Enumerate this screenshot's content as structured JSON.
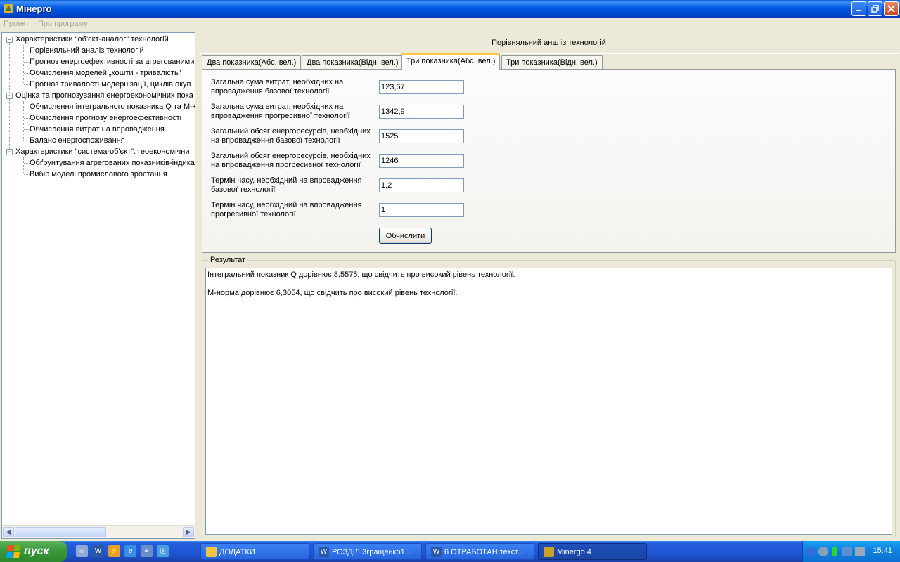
{
  "window": {
    "title": "Мінepro"
  },
  "menu": [
    "Проект",
    "Про програму"
  ],
  "tree": [
    {
      "label": "Характеристики  \"об'єкт-аналог\" технологій",
      "level": 0,
      "expanded": true
    },
    {
      "label": "Порівняльний аналіз технологій",
      "level": 1
    },
    {
      "label": "Прогноз енергоефективності за агрегованими",
      "level": 1
    },
    {
      "label": "Обчислення моделей „кошти - тривалість\"",
      "level": 1
    },
    {
      "label": "Прогноз тривалості модернізації, циклів окуп",
      "level": 1
    },
    {
      "label": "Оцінка та прогнозування енергоекономічних пока",
      "level": 0,
      "expanded": true
    },
    {
      "label": "Обчислення інтегрального показника Q та M-+",
      "level": 1
    },
    {
      "label": "Обчислення прогнозу енергоефективності",
      "level": 1
    },
    {
      "label": "Обчислення витрат на впровадження",
      "level": 1
    },
    {
      "label": "Баланс енергоспоживання",
      "level": 1
    },
    {
      "label": "Характеристики \"система-об'єкт\": геоекономічни",
      "level": 0,
      "expanded": true
    },
    {
      "label": "Обґрунтування агрегованих показників-індика",
      "level": 1
    },
    {
      "label": "Вибір моделі промислового зростання",
      "level": 1
    }
  ],
  "header": {
    "title": "Порівняльний аналіз технологій"
  },
  "tabs": [
    {
      "label": "Два показника(Абс. вел.)",
      "active": false
    },
    {
      "label": "Два показника(Відн. вел.)",
      "active": false
    },
    {
      "label": "Три показника(Абс. вел.)",
      "active": true
    },
    {
      "label": "Три показника(Відн. вел.)",
      "active": false
    }
  ],
  "fields": [
    {
      "label": "Загальна сума витрат, необхідних на впровадження базової технології",
      "value": "123,67"
    },
    {
      "label": "Загальна сума витрат, необхідних на впровадження прогресивної технології",
      "value": "1342,9"
    },
    {
      "label": "Загальний обсяг енергоресурсів, необхідних на впровадження базової технології",
      "value": "1525"
    },
    {
      "label": "Загальний обсяг енергоресурсів, необхідних на впровадження прогресивної технології",
      "value": "1246"
    },
    {
      "label": "Термін часу, необхідний на впровадження базової технології",
      "value": "1,2"
    },
    {
      "label": "Термін часу, необхідний на впровадження прогресивної технології",
      "value": "1"
    }
  ],
  "calc_button": "Обчислити",
  "result": {
    "legend": "Результат",
    "lines": [
      "Інтегральний показник Q дорівнює 8,5575, що свідчить про високий рівень технології.",
      "M-норма дорівнює 6,3054, що свідчить про високий рівень технології."
    ]
  },
  "taskbar": {
    "start_label": "пуск",
    "buttons": [
      {
        "label": "ДОДАТКИ",
        "icon": "folder-icon",
        "color": "#f2c443"
      },
      {
        "label": "РОЗДІЛ 3гращенко1...",
        "icon": "word-icon",
        "color": "#2b57a7"
      },
      {
        "label": "6 ОТРАБОТАН текст...",
        "icon": "word-icon",
        "color": "#2b57a7"
      },
      {
        "label": "Minergo 4",
        "icon": "app-icon",
        "color": "#c9a12a"
      }
    ],
    "clock": "15:41"
  }
}
